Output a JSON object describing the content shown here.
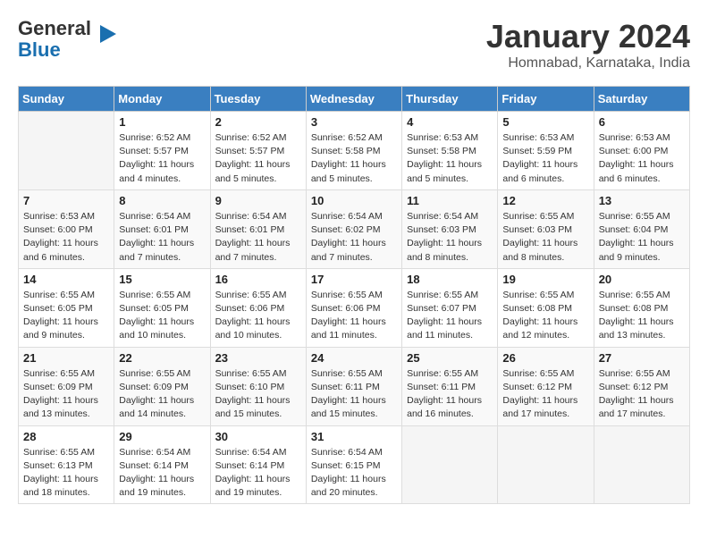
{
  "header": {
    "logo_line1": "General",
    "logo_line2": "Blue",
    "title": "January 2024",
    "subtitle": "Homnabad, Karnataka, India"
  },
  "columns": [
    "Sunday",
    "Monday",
    "Tuesday",
    "Wednesday",
    "Thursday",
    "Friday",
    "Saturday"
  ],
  "weeks": [
    [
      {
        "num": "",
        "info": ""
      },
      {
        "num": "1",
        "info": "Sunrise: 6:52 AM\nSunset: 5:57 PM\nDaylight: 11 hours\nand 4 minutes."
      },
      {
        "num": "2",
        "info": "Sunrise: 6:52 AM\nSunset: 5:57 PM\nDaylight: 11 hours\nand 5 minutes."
      },
      {
        "num": "3",
        "info": "Sunrise: 6:52 AM\nSunset: 5:58 PM\nDaylight: 11 hours\nand 5 minutes."
      },
      {
        "num": "4",
        "info": "Sunrise: 6:53 AM\nSunset: 5:58 PM\nDaylight: 11 hours\nand 5 minutes."
      },
      {
        "num": "5",
        "info": "Sunrise: 6:53 AM\nSunset: 5:59 PM\nDaylight: 11 hours\nand 6 minutes."
      },
      {
        "num": "6",
        "info": "Sunrise: 6:53 AM\nSunset: 6:00 PM\nDaylight: 11 hours\nand 6 minutes."
      }
    ],
    [
      {
        "num": "7",
        "info": "Sunrise: 6:53 AM\nSunset: 6:00 PM\nDaylight: 11 hours\nand 6 minutes."
      },
      {
        "num": "8",
        "info": "Sunrise: 6:54 AM\nSunset: 6:01 PM\nDaylight: 11 hours\nand 7 minutes."
      },
      {
        "num": "9",
        "info": "Sunrise: 6:54 AM\nSunset: 6:01 PM\nDaylight: 11 hours\nand 7 minutes."
      },
      {
        "num": "10",
        "info": "Sunrise: 6:54 AM\nSunset: 6:02 PM\nDaylight: 11 hours\nand 7 minutes."
      },
      {
        "num": "11",
        "info": "Sunrise: 6:54 AM\nSunset: 6:03 PM\nDaylight: 11 hours\nand 8 minutes."
      },
      {
        "num": "12",
        "info": "Sunrise: 6:55 AM\nSunset: 6:03 PM\nDaylight: 11 hours\nand 8 minutes."
      },
      {
        "num": "13",
        "info": "Sunrise: 6:55 AM\nSunset: 6:04 PM\nDaylight: 11 hours\nand 9 minutes."
      }
    ],
    [
      {
        "num": "14",
        "info": "Sunrise: 6:55 AM\nSunset: 6:05 PM\nDaylight: 11 hours\nand 9 minutes."
      },
      {
        "num": "15",
        "info": "Sunrise: 6:55 AM\nSunset: 6:05 PM\nDaylight: 11 hours\nand 10 minutes."
      },
      {
        "num": "16",
        "info": "Sunrise: 6:55 AM\nSunset: 6:06 PM\nDaylight: 11 hours\nand 10 minutes."
      },
      {
        "num": "17",
        "info": "Sunrise: 6:55 AM\nSunset: 6:06 PM\nDaylight: 11 hours\nand 11 minutes."
      },
      {
        "num": "18",
        "info": "Sunrise: 6:55 AM\nSunset: 6:07 PM\nDaylight: 11 hours\nand 11 minutes."
      },
      {
        "num": "19",
        "info": "Sunrise: 6:55 AM\nSunset: 6:08 PM\nDaylight: 11 hours\nand 12 minutes."
      },
      {
        "num": "20",
        "info": "Sunrise: 6:55 AM\nSunset: 6:08 PM\nDaylight: 11 hours\nand 13 minutes."
      }
    ],
    [
      {
        "num": "21",
        "info": "Sunrise: 6:55 AM\nSunset: 6:09 PM\nDaylight: 11 hours\nand 13 minutes."
      },
      {
        "num": "22",
        "info": "Sunrise: 6:55 AM\nSunset: 6:09 PM\nDaylight: 11 hours\nand 14 minutes."
      },
      {
        "num": "23",
        "info": "Sunrise: 6:55 AM\nSunset: 6:10 PM\nDaylight: 11 hours\nand 15 minutes."
      },
      {
        "num": "24",
        "info": "Sunrise: 6:55 AM\nSunset: 6:11 PM\nDaylight: 11 hours\nand 15 minutes."
      },
      {
        "num": "25",
        "info": "Sunrise: 6:55 AM\nSunset: 6:11 PM\nDaylight: 11 hours\nand 16 minutes."
      },
      {
        "num": "26",
        "info": "Sunrise: 6:55 AM\nSunset: 6:12 PM\nDaylight: 11 hours\nand 17 minutes."
      },
      {
        "num": "27",
        "info": "Sunrise: 6:55 AM\nSunset: 6:12 PM\nDaylight: 11 hours\nand 17 minutes."
      }
    ],
    [
      {
        "num": "28",
        "info": "Sunrise: 6:55 AM\nSunset: 6:13 PM\nDaylight: 11 hours\nand 18 minutes."
      },
      {
        "num": "29",
        "info": "Sunrise: 6:54 AM\nSunset: 6:14 PM\nDaylight: 11 hours\nand 19 minutes."
      },
      {
        "num": "30",
        "info": "Sunrise: 6:54 AM\nSunset: 6:14 PM\nDaylight: 11 hours\nand 19 minutes."
      },
      {
        "num": "31",
        "info": "Sunrise: 6:54 AM\nSunset: 6:15 PM\nDaylight: 11 hours\nand 20 minutes."
      },
      {
        "num": "",
        "info": ""
      },
      {
        "num": "",
        "info": ""
      },
      {
        "num": "",
        "info": ""
      }
    ]
  ]
}
